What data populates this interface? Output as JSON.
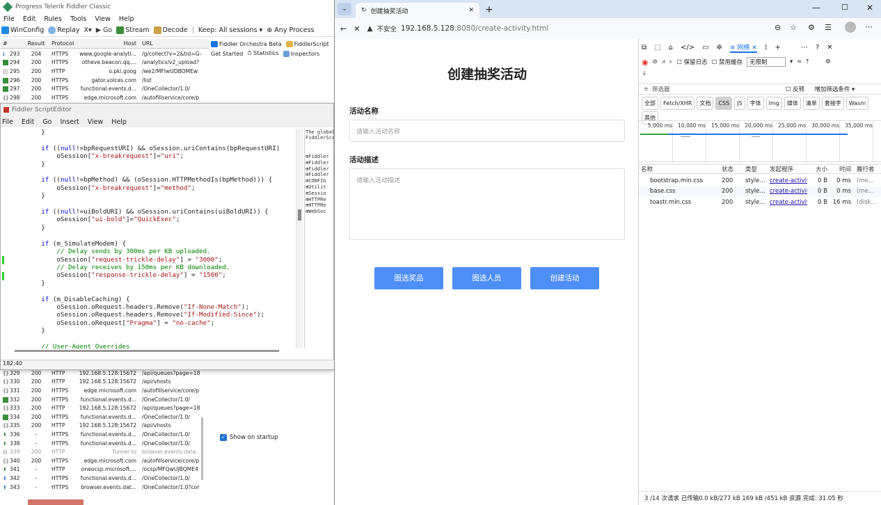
{
  "fiddler": {
    "title": "Progress Telerik Fiddler Classic",
    "menu": [
      "File",
      "Edit",
      "Rules",
      "Tools",
      "View",
      "Help"
    ],
    "toolbar": [
      "WinConfig",
      "Replay",
      "X▾",
      "▶ Go",
      "Stream",
      "Decode",
      "Keep: All sessions ▾",
      "Any Process"
    ],
    "headers": {
      "num": "#",
      "result": "Result",
      "protocol": "Protocol",
      "host": "Host",
      "url": "URL"
    },
    "right_tabs": [
      "Fiddler Orchestra Beta",
      "FiddlerScript",
      "Get Started",
      "Statistics",
      "Inspectors"
    ],
    "sessions_top": [
      {
        "num": "293",
        "result": "204",
        "protocol": "HTTPS",
        "host": "www.google-analyti...",
        "url": "/g/collect?v=2&tid=G-",
        "icon": "info"
      },
      {
        "num": "294",
        "result": "200",
        "protocol": "HTTPS",
        "host": "otheve.beacon.qq....",
        "url": "/analytics/v2_upload?",
        "icon": "img"
      },
      {
        "num": "295",
        "result": "200",
        "protocol": "HTTP",
        "host": "o.pki.goog",
        "url": "/we2/MFIwUDBOMEw",
        "icon": "doc"
      },
      {
        "num": "296",
        "result": "200",
        "protocol": "HTTPS",
        "host": "gator.volces.com",
        "url": "/list",
        "icon": "img"
      },
      {
        "num": "297",
        "result": "200",
        "protocol": "HTTPS",
        "host": "functional.events.d...",
        "url": "/OneCollector/1.0/",
        "icon": "img"
      },
      {
        "num": "298",
        "result": "200",
        "protocol": "HTTPS",
        "host": "edge.microsoft.com",
        "url": "/autofillservice/core/p",
        "icon": "json"
      }
    ],
    "sessions_bottom": [
      {
        "num": "329",
        "result": "200",
        "protocol": "HTTP",
        "host": "192.168.5.128:15672",
        "url": "/api/queues?page=18",
        "icon": "json"
      },
      {
        "num": "330",
        "result": "200",
        "protocol": "HTTP",
        "host": "192.168.5.128:15672",
        "url": "/api/vhosts",
        "icon": "json"
      },
      {
        "num": "331",
        "result": "200",
        "protocol": "HTTPS",
        "host": "edge.microsoft.com",
        "url": "/autofillservice/core/p",
        "icon": "json"
      },
      {
        "num": "332",
        "result": "200",
        "protocol": "HTTPS",
        "host": "functional.events.d...",
        "url": "/OneCollector/1.0/",
        "icon": "img"
      },
      {
        "num": "333",
        "result": "200",
        "protocol": "HTTP",
        "host": "192.168.5.128:15672",
        "url": "/api/queues?page=18",
        "icon": "json"
      },
      {
        "num": "334",
        "result": "200",
        "protocol": "HTTPS",
        "host": "functional.events.d...",
        "url": "/OneCollector/1.0/",
        "icon": "img"
      },
      {
        "num": "335",
        "result": "200",
        "protocol": "HTTP",
        "host": "192.168.5.128:15672",
        "url": "/api/vhosts",
        "icon": "json"
      },
      {
        "num": "336",
        "result": "-",
        "protocol": "HTTPS",
        "host": "functional.events.d...",
        "url": "/OneCollector/1.0/",
        "icon": "down"
      },
      {
        "num": "338",
        "result": "-",
        "protocol": "HTTPS",
        "host": "functional.events.d...",
        "url": "/OneCollector/1.0/",
        "icon": "down"
      },
      {
        "num": "339",
        "result": "200",
        "protocol": "HTTP",
        "host": "Tunnel to",
        "url": "browser.events.data.",
        "icon": "lock",
        "dim": true
      },
      {
        "num": "340",
        "result": "200",
        "protocol": "HTTPS",
        "host": "edge.microsoft.com",
        "url": "/autofillservice/core/p",
        "icon": "json"
      },
      {
        "num": "341",
        "result": "-",
        "protocol": "HTTP",
        "host": "oneocsp.microsoft....",
        "url": "/ocsp/MFQwUjBQME4",
        "icon": "down"
      },
      {
        "num": "342",
        "result": "-",
        "protocol": "HTTPS",
        "host": "functional.events.d...",
        "url": "/OneCollector/1.0/",
        "icon": "up"
      },
      {
        "num": "343",
        "result": "-",
        "protocol": "HTTPS",
        "host": "browser.events.dat...",
        "url": "/OneCollector/1.0?cor",
        "icon": "up"
      }
    ],
    "show_on_startup": "Show on startup"
  },
  "script_editor": {
    "title": "Fiddler ScriptEditor",
    "menu": [
      "File",
      "Edit",
      "Go",
      "Insert",
      "View",
      "Help"
    ],
    "side_text": "The global\nFiddlerScr",
    "side_tree": [
      "Fiddler",
      "Fiddler",
      "Fiddler",
      "Fiddler",
      "CONFIG",
      "Utilit",
      "Sessio",
      "HTTPRe",
      "HTTPRe",
      "WebSoc"
    ],
    "status": "182:40"
  },
  "edge": {
    "tab_title": "创建抽奖活动",
    "insecure_label": "不安全",
    "url_host": "192.168.5.128",
    "url_rest": ":8080/create-activity.html"
  },
  "page": {
    "title": "创建抽奖活动",
    "name_label": "活动名称",
    "name_placeholder": "请输入活动名称",
    "desc_label": "活动描述",
    "desc_placeholder": "请输入活动描述",
    "buttons": [
      "圈选奖品",
      "圈选人员",
      "创建活动"
    ],
    "accent": "#4e8ef7"
  },
  "devtools": {
    "network_tab": "网络",
    "preserve_log": "保留日志",
    "disable_cache": "禁用缓存",
    "throttle": "无限制",
    "filter_placeholder": "筛选器",
    "invert": "反转",
    "more_filters": "增加筛选条件 ▾",
    "types": [
      "全部",
      "Fetch/XHR",
      "文档",
      "CSS",
      "JS",
      "字体",
      "Img",
      "媒体",
      "清单",
      "套接字",
      "Wasm",
      "其他"
    ],
    "active_type": "CSS",
    "timeline_ticks": [
      "5,000 ms",
      "10,000 ms",
      "15,000 ms",
      "20,000 ms",
      "25,000 ms",
      "30,000 ms",
      "35,000 ms"
    ],
    "columns": [
      "名称",
      "状态",
      "类型",
      "发起程序",
      "大小",
      "时间",
      "履行者"
    ],
    "rows": [
      {
        "name": "bootstrap.min.css",
        "status": "200",
        "type": "style...",
        "initiator": "create-activit",
        "size": "0 B",
        "time": "0 ms",
        "fulfilled": "(me..."
      },
      {
        "name": "base.css",
        "status": "200",
        "type": "style...",
        "initiator": "create-activit",
        "size": "0 B",
        "time": "0 ms",
        "fulfilled": "(me..."
      },
      {
        "name": "toastr.min.css",
        "status": "200",
        "type": "style...",
        "initiator": "create-activit",
        "size": "0 B",
        "time": "16 ms",
        "fulfilled": "(disk..."
      }
    ],
    "status_bar": "3 /14 次请求  已传输0.0 kB/277 kB  169 kB /451 kB 资源  完成: 31.05 秒"
  }
}
